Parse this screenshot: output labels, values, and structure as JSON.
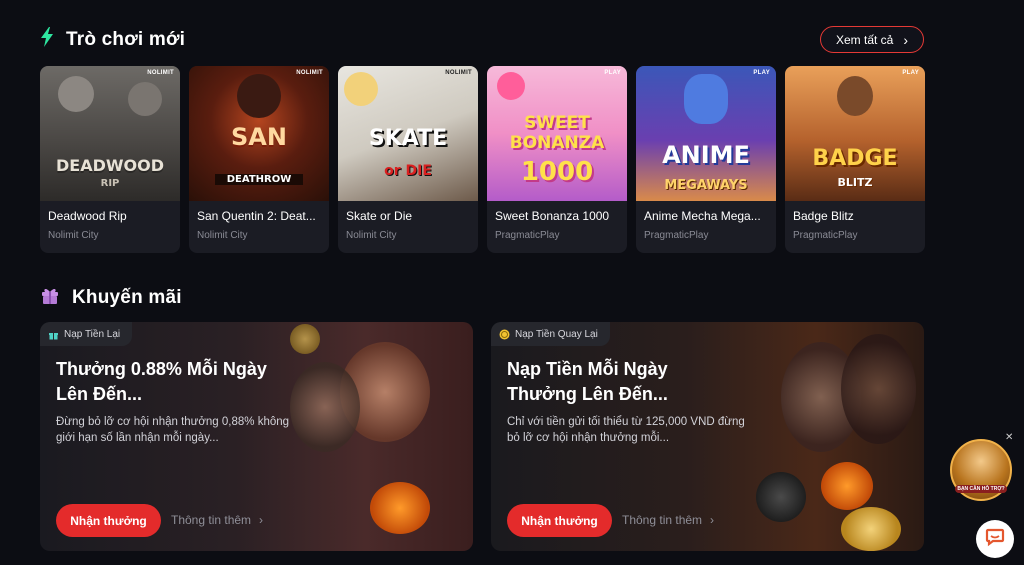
{
  "new_games": {
    "title": "Trò chơi mới",
    "view_all_label": "Xem tất cả",
    "games": [
      {
        "name": "Deadwood Rip",
        "provider": "Nolimit City",
        "logo": "DEADWOOD",
        "logo_sub": "RIP",
        "provider_mark": "NOLIMIT"
      },
      {
        "name": "San Quentin 2: Deat...",
        "provider": "Nolimit City",
        "logo": "SAN",
        "logo_sub": "DEATHROW",
        "provider_mark": "NOLIMIT"
      },
      {
        "name": "Skate or Die",
        "provider": "Nolimit City",
        "logo": "SKATE",
        "logo_sub": "or DIE",
        "provider_mark": "NOLIMIT"
      },
      {
        "name": "Sweet Bonanza 1000",
        "provider": "PragmaticPlay",
        "logo": "SWEET BONANZA",
        "logo_sub": "1000",
        "provider_mark": "PLAY"
      },
      {
        "name": "Anime Mecha Mega...",
        "provider": "PragmaticPlay",
        "logo": "ANIME",
        "logo_sub": "MEGAWAYS",
        "provider_mark": "PLAY"
      },
      {
        "name": "Badge Blitz",
        "provider": "PragmaticPlay",
        "logo": "BADGE",
        "logo_sub": "BLITZ",
        "provider_mark": "PLAY"
      }
    ]
  },
  "promotions": {
    "title": "Khuyến mãi",
    "cards": [
      {
        "tag": "Nạp Tiền Lại",
        "title": "Thưởng 0.88% Mỗi Ngày Lên Đến...",
        "description": "Đừng bỏ lỡ cơ hội nhận thưởng 0,88% không giới hạn số lần nhận mỗi ngày...",
        "claim_label": "Nhận thưởng",
        "more_label": "Thông tin thêm"
      },
      {
        "tag": "Nạp Tiền Quay Lại",
        "title": "Nạp Tiền Mỗi Ngày Thưởng Lên Đến...",
        "description": "Chỉ với tiền gửi tối thiểu từ 125,000 VND đừng bỏ lỡ cơ hội nhận thưởng mỗi...",
        "claim_label": "Nhận thưởng",
        "more_label": "Thông tin thêm"
      }
    ]
  },
  "support": {
    "badge_label": "BẠN CẦN HỖ TRỢ?"
  },
  "colors": {
    "accent_red": "#e42b2b",
    "bolt_green": "#2ee6a0",
    "gift_purple": "#b57bd6",
    "background": "#0c0d13"
  }
}
